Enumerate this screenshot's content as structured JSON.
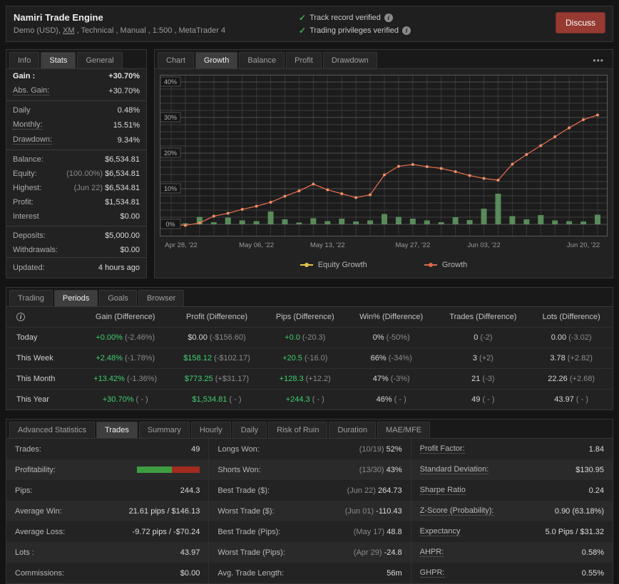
{
  "header": {
    "title": "Namiri Trade Engine",
    "subtitle_prefix": "Demo (USD), ",
    "subtitle_link": "XM",
    "subtitle_suffix": " , Technical , Manual , 1:500 , MetaTrader 4",
    "verified": [
      {
        "text": "Track record verified"
      },
      {
        "text": "Trading privileges verified"
      }
    ],
    "discuss_label": "Discuss"
  },
  "left_panel": {
    "tabs": [
      {
        "label": "Info"
      },
      {
        "label": "Stats",
        "active": true
      },
      {
        "label": "General"
      }
    ],
    "rows": [
      {
        "label": "Gain :",
        "bold": true,
        "value": "+30.70%",
        "green": true
      },
      {
        "label": "Abs. Gain:",
        "dotted": true,
        "value": "+30.70%",
        "green": true,
        "sep": true
      },
      {
        "label": "Daily",
        "value": "0.48%"
      },
      {
        "label": "Monthly:",
        "dotted": true,
        "value": "15.51%"
      },
      {
        "label": "Drawdown:",
        "dotted": true,
        "value": "9.34%",
        "sep": true
      },
      {
        "label": "Balance:",
        "value": "$6,534.81"
      },
      {
        "label": "Equity:",
        "muted": "(100.00%)",
        "value": "$6,534.81"
      },
      {
        "label": "Highest:",
        "muted": "(Jun 22)",
        "value": "$6,534.81"
      },
      {
        "label": "Profit:",
        "value": "$1,534.81",
        "green": true
      },
      {
        "label": "Interest",
        "value": "$0.00",
        "sep": true
      },
      {
        "label": "Deposits:",
        "value": "$5,000.00"
      },
      {
        "label": "Withdrawals:",
        "value": "$0.00"
      },
      {
        "label": "Updated:",
        "value": "4 hours ago",
        "updated": true
      }
    ]
  },
  "chart_panel": {
    "tabs": [
      {
        "label": "Chart"
      },
      {
        "label": "Growth",
        "active": true
      },
      {
        "label": "Balance"
      },
      {
        "label": "Profit"
      },
      {
        "label": "Drawdown"
      }
    ],
    "menu_label": "•••"
  },
  "chart_data": {
    "type": "line",
    "title": "Growth",
    "ylabel": "%",
    "ylim": [
      0,
      40
    ],
    "y_ticks": [
      0,
      10,
      20,
      30,
      40
    ],
    "x_tick_labels": [
      "Apr 28, '22",
      "May 06, '22",
      "May 13, '22",
      "May 27, '22",
      "Jun 03, '22",
      "Jun 20, '22"
    ],
    "x_tick_indices": [
      0,
      6,
      11,
      17,
      22,
      29
    ],
    "grid": true,
    "legend_position": "bottom",
    "series": [
      {
        "name": "Growth",
        "type": "line",
        "color": "#dd6a4d",
        "values": [
          0,
          -0.3,
          0.4,
          2.3,
          3.1,
          4.2,
          5.1,
          6.2,
          7.9,
          9.4,
          11.3,
          9.7,
          8.6,
          7.5,
          8.3,
          13.9,
          16.3,
          16.8,
          16.2,
          15.7,
          14.8,
          13.7,
          12.9,
          12.4,
          16.9,
          19.6,
          22.1,
          24.6,
          27.1,
          29.4,
          30.7
        ]
      },
      {
        "name": "Equity Growth",
        "type": "bar",
        "color": "#5e9460",
        "values": [
          0.1,
          0.3,
          2.1,
          0.6,
          1.9,
          1.1,
          0.9,
          3.6,
          1.4,
          0.5,
          1.7,
          0.9,
          1.6,
          0.8,
          1.1,
          2.9,
          2.1,
          1.6,
          1.1,
          0.6,
          2.0,
          1.2,
          4.4,
          8.6,
          2.3,
          1.4,
          2.6,
          1.1,
          0.9,
          0.8,
          2.7
        ]
      }
    ],
    "legend": [
      {
        "label": "Equity Growth",
        "color": "#e3c74b"
      },
      {
        "label": "Growth",
        "color": "#dd6a4d"
      }
    ]
  },
  "periods": {
    "tabs": [
      {
        "label": "Trading"
      },
      {
        "label": "Periods",
        "active": true
      },
      {
        "label": "Goals"
      },
      {
        "label": "Browser"
      }
    ],
    "columns": [
      "Gain (Difference)",
      "Profit (Difference)",
      "Pips (Difference)",
      "Win% (Difference)",
      "Trades (Difference)",
      "Lots (Difference)"
    ],
    "rows": [
      {
        "period": "Today",
        "cells": [
          {
            "main": "+0.00%",
            "green": true,
            "diff": "(-2.46%)"
          },
          {
            "main": "$0.00",
            "diff": "(-$156.60)"
          },
          {
            "main": "+0.0",
            "green": true,
            "diff": "(-20.3)"
          },
          {
            "main": "0%",
            "diff": "(-50%)"
          },
          {
            "main": "0",
            "diff": "(-2)"
          },
          {
            "main": "0.00",
            "diff": "(-3.02)"
          }
        ]
      },
      {
        "period": "This Week",
        "cells": [
          {
            "main": "+2.48%",
            "green": true,
            "diff": "(-1.78%)"
          },
          {
            "main": "$158.12",
            "green": true,
            "diff": "(-$102.17)"
          },
          {
            "main": "+20.5",
            "green": true,
            "diff": "(-16.0)"
          },
          {
            "main": "66%",
            "diff": "(-34%)"
          },
          {
            "main": "3",
            "diff": "(+2)"
          },
          {
            "main": "3.78",
            "diff": "(+2.82)"
          }
        ]
      },
      {
        "period": "This Month",
        "cells": [
          {
            "main": "+13.42%",
            "green": true,
            "diff": "(-1.36%)"
          },
          {
            "main": "$773.25",
            "green": true,
            "diff": "(+$31.17)"
          },
          {
            "main": "+128.3",
            "green": true,
            "diff": "(+12.2)"
          },
          {
            "main": "47%",
            "diff": "(-3%)"
          },
          {
            "main": "21",
            "diff": "(-3)"
          },
          {
            "main": "22.26",
            "diff": "(+2.68)"
          }
        ]
      },
      {
        "period": "This Year",
        "cells": [
          {
            "main": "+30.70%",
            "green": true,
            "diff": "( - )"
          },
          {
            "main": "$1,534.81",
            "green": true,
            "diff": "( - )"
          },
          {
            "main": "+244.3",
            "green": true,
            "diff": "( - )"
          },
          {
            "main": "46%",
            "diff": "( - )"
          },
          {
            "main": "49",
            "diff": "( - )"
          },
          {
            "main": "43.97",
            "diff": "( - )"
          }
        ]
      }
    ]
  },
  "advanced": {
    "tabs": [
      {
        "label": "Advanced Statistics"
      },
      {
        "label": "Trades",
        "active": true
      },
      {
        "label": "Summary"
      },
      {
        "label": "Hourly"
      },
      {
        "label": "Daily"
      },
      {
        "label": "Risk of Ruin"
      },
      {
        "label": "Duration"
      },
      {
        "label": "MAE/MFE"
      }
    ],
    "columns": [
      [
        {
          "label": "Trades:",
          "value": "49"
        },
        {
          "label": "Profitability:",
          "bar": {
            "green_pct": 55
          }
        },
        {
          "label": "Pips:",
          "value": "244.3"
        },
        {
          "label": "Average Win:",
          "value": "21.61 pips / $146.13"
        },
        {
          "label": "Average Loss:",
          "value": "-9.72 pips / -$70.24"
        },
        {
          "label": "Lots :",
          "value": "43.97"
        },
        {
          "label": "Commissions:",
          "value": "$0.00"
        }
      ],
      [
        {
          "label": "Longs Won:",
          "muted": "(10/19)",
          "value": "52%"
        },
        {
          "label": "Shorts Won:",
          "muted": "(13/30)",
          "value": "43%"
        },
        {
          "label": "Best Trade ($):",
          "muted": "(Jun 22)",
          "value": "264.73"
        },
        {
          "label": "Worst Trade ($):",
          "muted": "(Jun 01)",
          "value": "-110.43"
        },
        {
          "label": "Best Trade (Pips):",
          "muted": "(May 17)",
          "value": "48.8"
        },
        {
          "label": "Worst Trade (Pips):",
          "muted": "(Apr 29)",
          "value": "-24.8"
        },
        {
          "label": "Avg. Trade Length:",
          "value": "56m"
        }
      ],
      [
        {
          "label": "Profit Factor:",
          "dotted": true,
          "value": "1.84"
        },
        {
          "label": "Standard Deviation:",
          "dotted": true,
          "value": "$130.95"
        },
        {
          "label": "Sharpe Ratio",
          "dotted": true,
          "value": "0.24"
        },
        {
          "label": "Z-Score (Probability):",
          "dotted": true,
          "value": "0.90 (63.18%)"
        },
        {
          "label": "Expectancy",
          "dotted": true,
          "value": "5.0 Pips / $31.32"
        },
        {
          "label": "AHPR:",
          "dotted": true,
          "value": "0.58%"
        },
        {
          "label": "GHPR:",
          "dotted": true,
          "value": "0.55%"
        }
      ]
    ]
  }
}
